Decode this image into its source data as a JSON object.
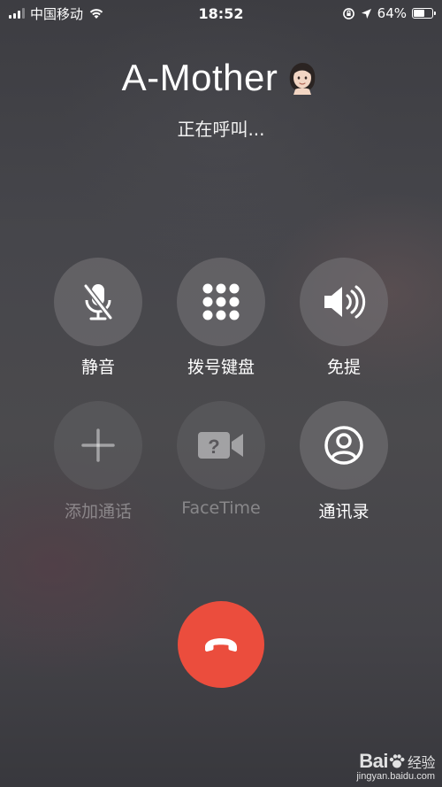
{
  "status_bar": {
    "carrier": "中国移动",
    "time": "18:52",
    "battery_text": "64%",
    "battery_level": 0.64,
    "signal_bars_active": 3,
    "signal_bars_total": 4
  },
  "caller": {
    "name": "A-Mother",
    "status": "正在呼叫..."
  },
  "buttons": [
    {
      "label": "静音",
      "icon": "mute-microphone-icon",
      "enabled": true
    },
    {
      "label": "拨号键盘",
      "icon": "keypad-icon",
      "enabled": true
    },
    {
      "label": "免提",
      "icon": "speaker-icon",
      "enabled": true
    },
    {
      "label": "添加通话",
      "icon": "plus-icon",
      "enabled": false
    },
    {
      "label": "FaceTime",
      "icon": "facetime-video-icon",
      "enabled": false
    },
    {
      "label": "通讯录",
      "icon": "contacts-icon",
      "enabled": true
    }
  ],
  "end_call": {
    "icon": "end-call-phone-icon",
    "color": "#eb4d3d"
  },
  "watermark": {
    "brand": "Bai",
    "brand_suffix": "经验",
    "url": "jingyan.baidu.com"
  }
}
